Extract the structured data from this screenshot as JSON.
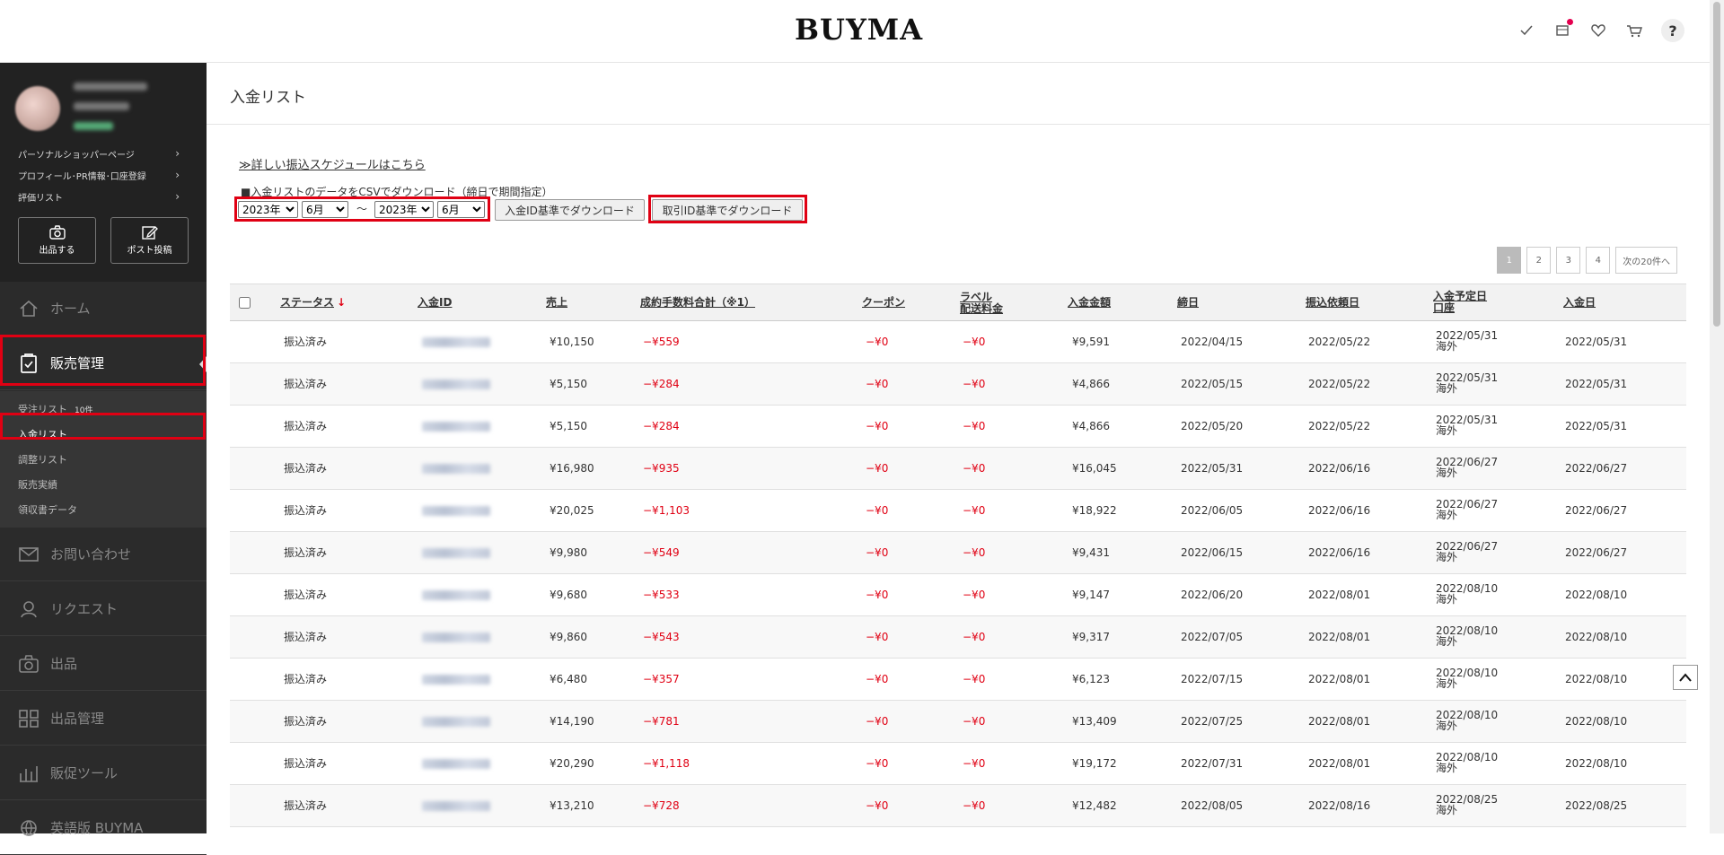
{
  "header": {
    "logo": "BUYMA"
  },
  "sidebar": {
    "links": [
      {
        "label": "パーソナルショッパーページ"
      },
      {
        "label": "プロフィール･PR情報･口座登録"
      },
      {
        "label": "評価リスト"
      }
    ],
    "quick_buttons": [
      {
        "label": "出品する",
        "icon": "camera-icon"
      },
      {
        "label": "ポスト投稿",
        "icon": "edit-icon"
      }
    ],
    "nav": {
      "home": "ホーム",
      "sales": "販売管理",
      "contact": "お問い合わせ",
      "request": "リクエスト",
      "listing": "出品",
      "listing_manage": "出品管理",
      "promo_tools": "販促ツール",
      "english": "英語版 BUYMA"
    },
    "sub_items": {
      "orders": "受注リスト",
      "orders_count": "10件",
      "deposits": "入金リスト",
      "adjust": "調整リスト",
      "results": "販売実績",
      "receipts": "領収書データ"
    }
  },
  "main": {
    "title": "入金リスト",
    "schedule_link": "≫詳しい振込スケジュールはこちら",
    "csv_label": "■入金リストのデータをCSVでダウンロード（締日で期間指定）",
    "from_year": "2023年",
    "from_month": "6月",
    "tilde": "〜",
    "to_year": "2023年",
    "to_month": "6月",
    "btn_deposit_id": "入金ID基準でダウンロード",
    "btn_trade_id": "取引ID基準でダウンロード",
    "pagination": {
      "pages": [
        "1",
        "2",
        "3",
        "4"
      ],
      "current": "1",
      "next": "次の20件へ"
    }
  },
  "table": {
    "headers": {
      "status": "ステータス",
      "status_arrow": "↓",
      "deposit_id": "入金ID",
      "sales": "売上",
      "fee": "成約手数料合計（※1）",
      "coupon": "クーポン",
      "label_line1": "ラベル",
      "label_line2": "配送料金",
      "amount": "入金金額",
      "closing": "締日",
      "request_date": "振込依頼日",
      "scheduled_line1": "入金予定日",
      "scheduled_line2": "口座",
      "deposit_date": "入金日"
    },
    "rows": [
      {
        "status": "振込済み",
        "sales": "¥10,150",
        "fee": "−¥559",
        "coupon": "−¥0",
        "label_fee": "−¥0",
        "amount": "¥9,591",
        "closing": "2022/04/15",
        "request": "2022/05/22",
        "sched": "2022/05/31",
        "acct": "海外",
        "deposit": "2022/05/31"
      },
      {
        "status": "振込済み",
        "sales": "¥5,150",
        "fee": "−¥284",
        "coupon": "−¥0",
        "label_fee": "−¥0",
        "amount": "¥4,866",
        "closing": "2022/05/15",
        "request": "2022/05/22",
        "sched": "2022/05/31",
        "acct": "海外",
        "deposit": "2022/05/31"
      },
      {
        "status": "振込済み",
        "sales": "¥5,150",
        "fee": "−¥284",
        "coupon": "−¥0",
        "label_fee": "−¥0",
        "amount": "¥4,866",
        "closing": "2022/05/20",
        "request": "2022/05/22",
        "sched": "2022/05/31",
        "acct": "海外",
        "deposit": "2022/05/31"
      },
      {
        "status": "振込済み",
        "sales": "¥16,980",
        "fee": "−¥935",
        "coupon": "−¥0",
        "label_fee": "−¥0",
        "amount": "¥16,045",
        "closing": "2022/05/31",
        "request": "2022/06/16",
        "sched": "2022/06/27",
        "acct": "海外",
        "deposit": "2022/06/27"
      },
      {
        "status": "振込済み",
        "sales": "¥20,025",
        "fee": "−¥1,103",
        "coupon": "−¥0",
        "label_fee": "−¥0",
        "amount": "¥18,922",
        "closing": "2022/06/05",
        "request": "2022/06/16",
        "sched": "2022/06/27",
        "acct": "海外",
        "deposit": "2022/06/27"
      },
      {
        "status": "振込済み",
        "sales": "¥9,980",
        "fee": "−¥549",
        "coupon": "−¥0",
        "label_fee": "−¥0",
        "amount": "¥9,431",
        "closing": "2022/06/15",
        "request": "2022/06/16",
        "sched": "2022/06/27",
        "acct": "海外",
        "deposit": "2022/06/27"
      },
      {
        "status": "振込済み",
        "sales": "¥9,680",
        "fee": "−¥533",
        "coupon": "−¥0",
        "label_fee": "−¥0",
        "amount": "¥9,147",
        "closing": "2022/06/20",
        "request": "2022/08/01",
        "sched": "2022/08/10",
        "acct": "海外",
        "deposit": "2022/08/10"
      },
      {
        "status": "振込済み",
        "sales": "¥9,860",
        "fee": "−¥543",
        "coupon": "−¥0",
        "label_fee": "−¥0",
        "amount": "¥9,317",
        "closing": "2022/07/05",
        "request": "2022/08/01",
        "sched": "2022/08/10",
        "acct": "海外",
        "deposit": "2022/08/10"
      },
      {
        "status": "振込済み",
        "sales": "¥6,480",
        "fee": "−¥357",
        "coupon": "−¥0",
        "label_fee": "−¥0",
        "amount": "¥6,123",
        "closing": "2022/07/15",
        "request": "2022/08/01",
        "sched": "2022/08/10",
        "acct": "海外",
        "deposit": "2022/08/10"
      },
      {
        "status": "振込済み",
        "sales": "¥14,190",
        "fee": "−¥781",
        "coupon": "−¥0",
        "label_fee": "−¥0",
        "amount": "¥13,409",
        "closing": "2022/07/25",
        "request": "2022/08/01",
        "sched": "2022/08/10",
        "acct": "海外",
        "deposit": "2022/08/10"
      },
      {
        "status": "振込済み",
        "sales": "¥20,290",
        "fee": "−¥1,118",
        "coupon": "−¥0",
        "label_fee": "−¥0",
        "amount": "¥19,172",
        "closing": "2022/07/31",
        "request": "2022/08/01",
        "sched": "2022/08/10",
        "acct": "海外",
        "deposit": "2022/08/10"
      },
      {
        "status": "振込済み",
        "sales": "¥13,210",
        "fee": "−¥728",
        "coupon": "−¥0",
        "label_fee": "−¥0",
        "amount": "¥12,482",
        "closing": "2022/08/05",
        "request": "2022/08/16",
        "sched": "2022/08/25",
        "acct": "海外",
        "deposit": "2022/08/25"
      }
    ]
  },
  "colors": {
    "accent_red": "#e00013",
    "sidebar_bg": "#2b2b2b",
    "notification": "#e4004f"
  }
}
